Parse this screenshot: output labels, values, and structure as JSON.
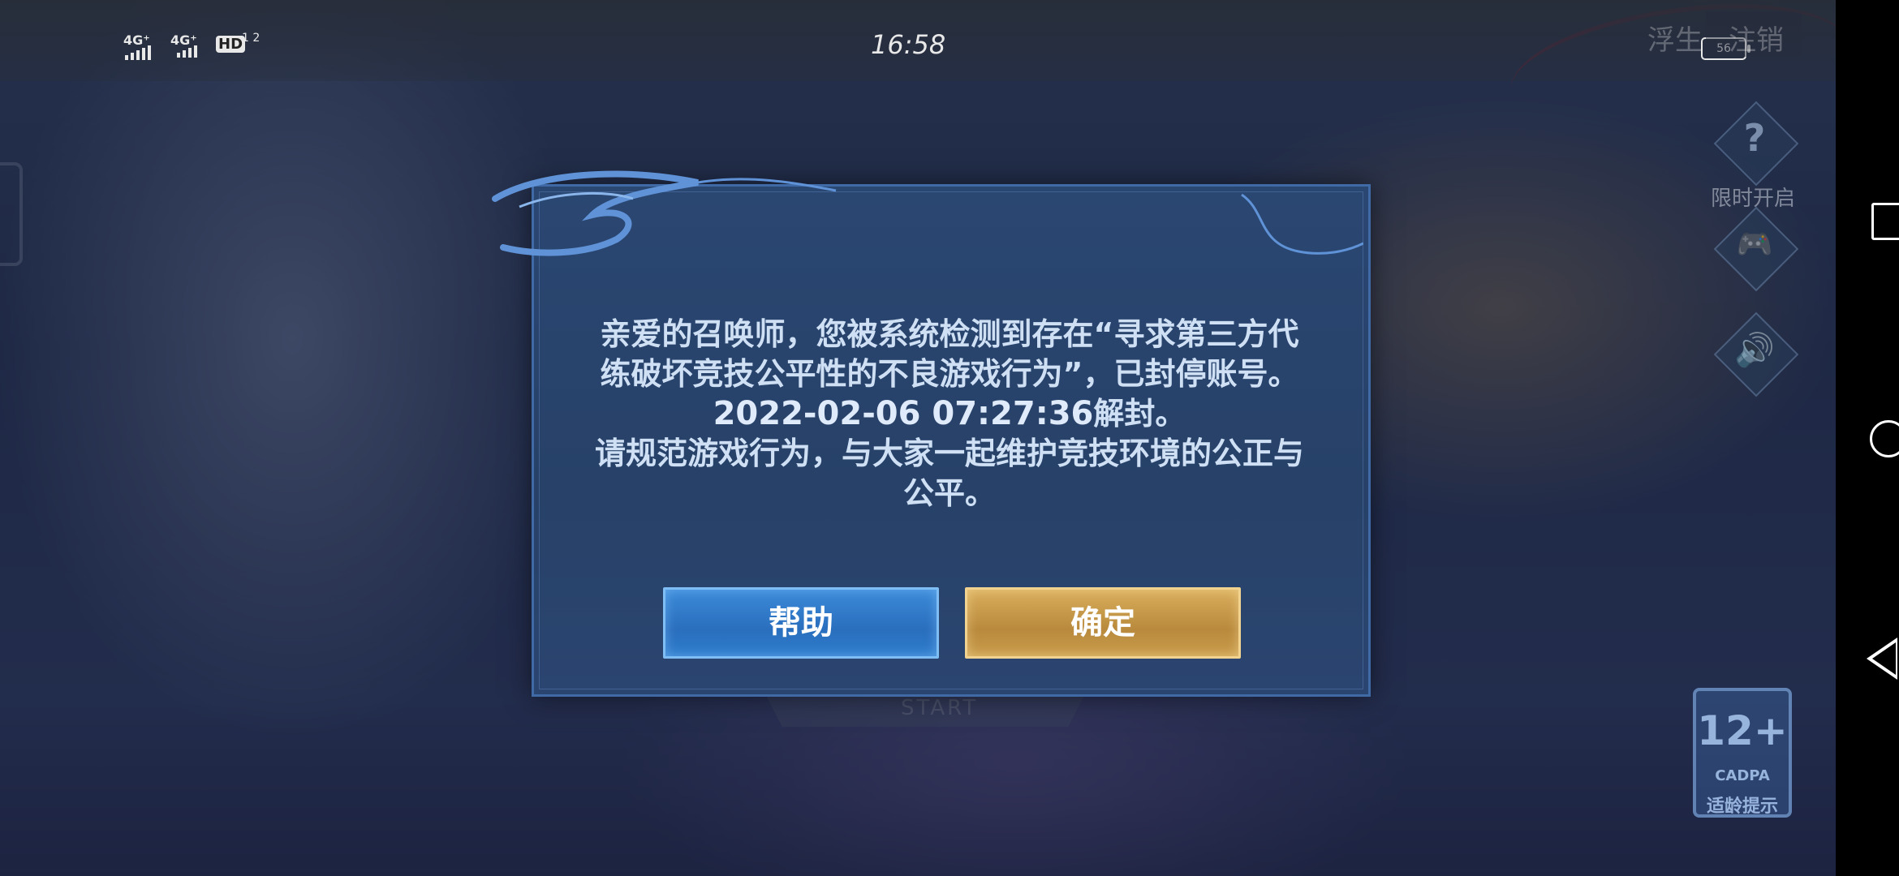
{
  "status_bar": {
    "network_1": "4G⁺",
    "network_2": "4G⁺",
    "hd_label": "HD",
    "hd_sim": "1 2",
    "time": "16:58",
    "battery": "56"
  },
  "top_right": {
    "float_label": "浮生",
    "logout_label": "注销"
  },
  "side_controls": {
    "limit_label": "限时开启",
    "icons": [
      "question-icon",
      "gamepad-icon",
      "speaker-icon"
    ]
  },
  "dialog": {
    "line1": "亲爱的召唤师，您被系统检测到存在“寻求第三方代",
    "line2": "练破坏竞技公平性的不良游戏行为”，已封停账号。",
    "unban_date": "2022-02-06 07:27:36",
    "unban_suffix": "解封。",
    "line4": "请规范游戏行为，与大家一起维护竞技环境的公正与",
    "line5": "公平。",
    "help_button": "帮助",
    "confirm_button": "确定"
  },
  "age_badge": {
    "rating": "12+",
    "org": "CADPA",
    "tip": "适龄提示"
  },
  "colors": {
    "dialog_bg": "#274168",
    "dialog_border": "#3f6aa6",
    "help_button": "#2a6fbe",
    "confirm_button": "#b98a3d",
    "text": "#cfe0f5"
  }
}
